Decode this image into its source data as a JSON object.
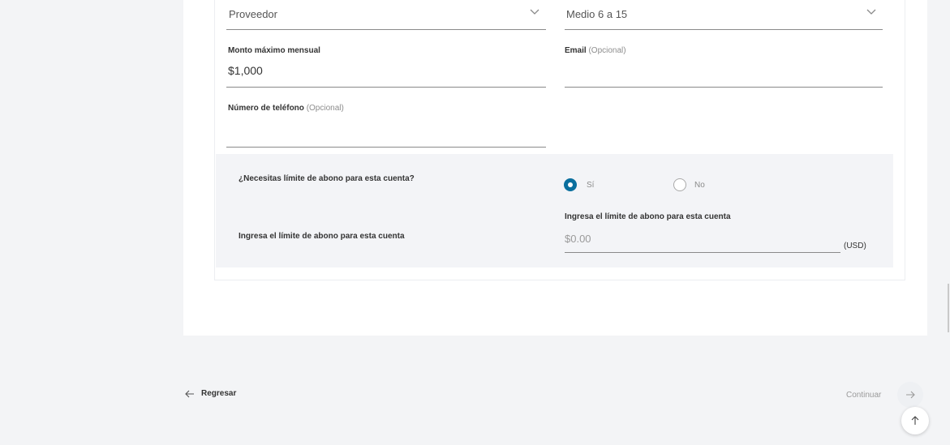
{
  "form": {
    "type_select": {
      "value": "Proveedor"
    },
    "channel_select": {
      "value": "Medio 6 a 15"
    },
    "monthly_max": {
      "label": "Monto máximo mensual",
      "value": "$1,000"
    },
    "email": {
      "label": "Email",
      "optional": "(Opcional)",
      "value": ""
    },
    "phone": {
      "label": "Número de teléfono",
      "optional": "(Opcional)",
      "value": ""
    }
  },
  "limit_section": {
    "question": "¿Necesitas límite de abono para esta cuenta?",
    "options": [
      {
        "label": "Sí",
        "selected": true
      },
      {
        "label": "No",
        "selected": false
      }
    ],
    "row_label": "Ingresa el límite de abono para esta cuenta",
    "input_label": "Ingresa el límite de abono para esta cuenta",
    "input_placeholder": "$0.00",
    "unit": "(USD)"
  },
  "footer": {
    "back_label": "Regresar",
    "next_label": "Continuar"
  },
  "colors": {
    "accent": "#0a6f9e",
    "band_bg": "#f3f4f7",
    "page_bg": "#f3f4f6"
  },
  "icons": {
    "select_chevron": "chevron-down-icon",
    "back": "arrow-left-icon",
    "next": "arrow-right-icon",
    "scroll_top": "arrow-up-icon"
  }
}
